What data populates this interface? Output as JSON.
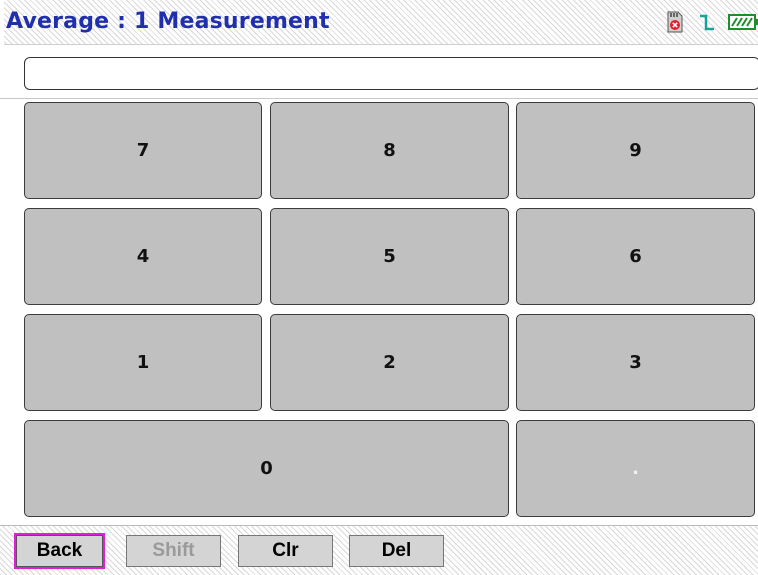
{
  "header": {
    "title": "Average : 1 Measurement",
    "status_icons": [
      "sd-card-error-icon",
      "trigger-pulse-icon",
      "battery-icon"
    ],
    "colors": {
      "title": "#1f2fae",
      "sd_error": "#e0202a",
      "pulse": "#13a39a",
      "battery": "#1d8f2a"
    }
  },
  "entry": {
    "value": ""
  },
  "keypad": {
    "keys": [
      "7",
      "8",
      "9",
      "4",
      "5",
      "6",
      "1",
      "2",
      "3",
      "0",
      "."
    ]
  },
  "softkeys": {
    "back": "Back",
    "shift": "Shift",
    "clr": "Clr",
    "del": "Del"
  }
}
